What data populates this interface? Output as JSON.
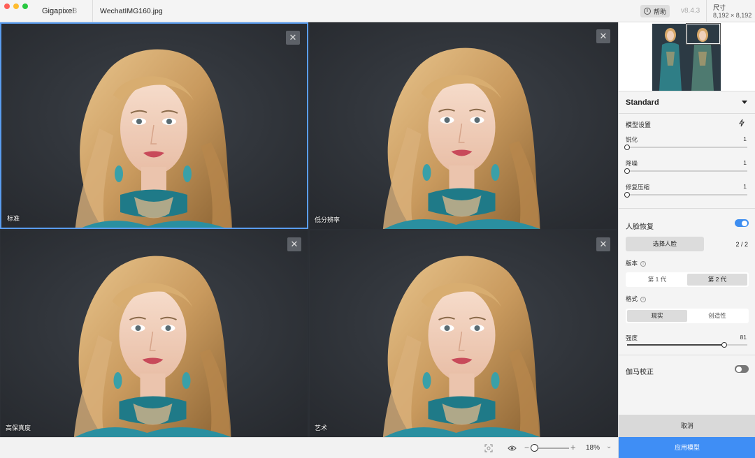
{
  "titlebar": {
    "app_name": "Gigapixel",
    "app_version": "8",
    "file_name": "WechatIMG160.jpg",
    "help_label": "帮助",
    "version": "v8.4.3",
    "size_label": "尺寸",
    "size_value": "8,192 × 8,192"
  },
  "previews": [
    {
      "label": "标准",
      "selected": true
    },
    {
      "label": "低分辨率",
      "selected": false
    },
    {
      "label": "高保真度",
      "selected": false
    },
    {
      "label": "艺术",
      "selected": false
    }
  ],
  "bottombar": {
    "zoom_value": "18%",
    "zoom_level_fraction": 0.0
  },
  "sidebar": {
    "model": "Standard",
    "model_settings_title": "模型设置",
    "sliders": [
      {
        "label": "锐化",
        "value": "1",
        "fraction": 0.0
      },
      {
        "label": "降噪",
        "value": "1",
        "fraction": 0.0
      },
      {
        "label": "修复压缩",
        "value": "1",
        "fraction": 0.0
      }
    ],
    "face_recovery": {
      "title": "人脸恢复",
      "enabled": true,
      "select_faces_label": "选择人脸",
      "face_count": "2 / 2",
      "version_label": "版本",
      "versions": [
        "第 1 代",
        "第 2 代"
      ],
      "version_selected": 1,
      "style_label": "格式",
      "styles": [
        "现实",
        "创造性"
      ],
      "style_selected": 0,
      "strength_label": "强度",
      "strength_value": "81",
      "strength_fraction": 0.81
    },
    "gamma": {
      "title": "伽马校正",
      "enabled": false
    },
    "cancel_label": "取消",
    "apply_label": "应用模型"
  },
  "colors": {
    "accent": "#3f8ef5",
    "selection_border": "#5a9df0",
    "preview_bg": "#30343a"
  }
}
